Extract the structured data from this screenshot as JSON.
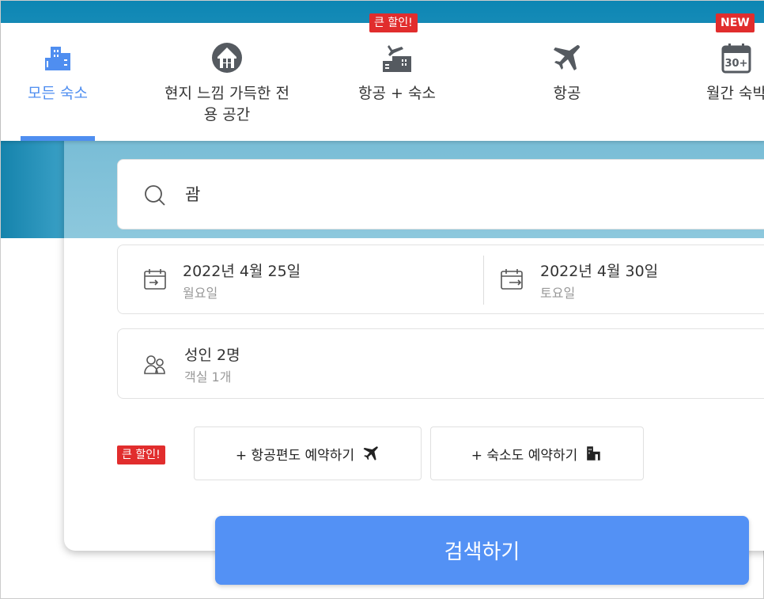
{
  "nav": {
    "tabs": [
      {
        "label": "모든 숙소",
        "icon": "building-icon",
        "active": true
      },
      {
        "label": "현지 느낌 가득한 전용 공간",
        "icon": "home-circle-icon"
      },
      {
        "label": "항공 + 숙소",
        "icon": "flight-hotel-icon",
        "badge": "큰 할인!"
      },
      {
        "label": "항공",
        "icon": "airplane-icon"
      },
      {
        "label": "월간 숙박",
        "icon": "calendar-30-icon",
        "badge": "NEW"
      }
    ]
  },
  "search": {
    "value": "괌"
  },
  "dates": {
    "checkin": "2022년 4월 25일",
    "checkin_day": "월요일",
    "checkout": "2022년 4월 30일",
    "checkout_day": "토요일"
  },
  "guests": {
    "adults": "성인 2명",
    "rooms": "객실 1개"
  },
  "addons": {
    "badge": "큰 할인!",
    "flight": "+ 항공편도 예약하기",
    "hotel": "+ 숙소도 예약하기"
  },
  "submit": "검색하기",
  "colors": {
    "accent": "#4f8ef0",
    "button": "#5391f5",
    "badge": "#e12d2d"
  }
}
